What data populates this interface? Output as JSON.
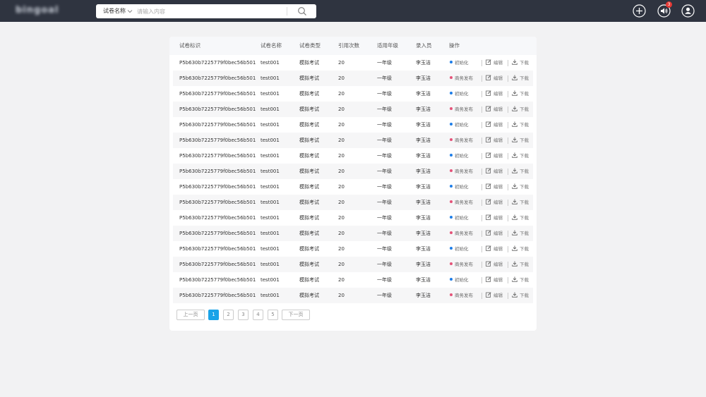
{
  "header": {
    "logo_text": "bingoal",
    "search": {
      "category": "试卷名称",
      "placeholder": "请输入内容"
    },
    "notification_count": "3"
  },
  "table": {
    "columns": [
      "试卷标识",
      "试卷名称",
      "试卷类型",
      "引用次数",
      "适用年级",
      "录入员",
      "操作"
    ],
    "rows": [
      {
        "id": "P5b630b7225779f0bec56b501",
        "name": "test001",
        "type": "模拟考试",
        "refs": "20",
        "grade": "一年级",
        "author": "李玉洁",
        "status": "初始化",
        "status_color": "#1e7ee8",
        "edit": "编辑",
        "download": "下载"
      },
      {
        "id": "P5b630b7225779f0bec56b501",
        "name": "test001",
        "type": "模拟考试",
        "refs": "20",
        "grade": "一年级",
        "author": "李玉洁",
        "status": "商务发布",
        "status_color": "#e5547a",
        "edit": "编辑",
        "download": "下载"
      },
      {
        "id": "P5b630b7225779f0bec56b501",
        "name": "test001",
        "type": "模拟考试",
        "refs": "20",
        "grade": "一年级",
        "author": "李玉洁",
        "status": "初始化",
        "status_color": "#1e7ee8",
        "edit": "编辑",
        "download": "下载"
      },
      {
        "id": "P5b630b7225779f0bec56b501",
        "name": "test001",
        "type": "模拟考试",
        "refs": "20",
        "grade": "一年级",
        "author": "李玉洁",
        "status": "商务发布",
        "status_color": "#e5547a",
        "edit": "编辑",
        "download": "下载"
      },
      {
        "id": "P5b630b7225779f0bec56b501",
        "name": "test001",
        "type": "模拟考试",
        "refs": "20",
        "grade": "一年级",
        "author": "李玉洁",
        "status": "初始化",
        "status_color": "#1e7ee8",
        "edit": "编辑",
        "download": "下载"
      },
      {
        "id": "P5b630b7225779f0bec56b501",
        "name": "test001",
        "type": "模拟考试",
        "refs": "20",
        "grade": "一年级",
        "author": "李玉洁",
        "status": "商务发布",
        "status_color": "#e5547a",
        "edit": "编辑",
        "download": "下载"
      },
      {
        "id": "P5b630b7225779f0bec56b501",
        "name": "test001",
        "type": "模拟考试",
        "refs": "20",
        "grade": "一年级",
        "author": "李玉洁",
        "status": "初始化",
        "status_color": "#1e7ee8",
        "edit": "编辑",
        "download": "下载"
      },
      {
        "id": "P5b630b7225779f0bec56b501",
        "name": "test001",
        "type": "模拟考试",
        "refs": "20",
        "grade": "一年级",
        "author": "李玉洁",
        "status": "商务发布",
        "status_color": "#e5547a",
        "edit": "编辑",
        "download": "下载"
      },
      {
        "id": "P5b630b7225779f0bec56b501",
        "name": "test001",
        "type": "模拟考试",
        "refs": "20",
        "grade": "一年级",
        "author": "李玉洁",
        "status": "初始化",
        "status_color": "#1e7ee8",
        "edit": "编辑",
        "download": "下载"
      },
      {
        "id": "P5b630b7225779f0bec56b501",
        "name": "test001",
        "type": "模拟考试",
        "refs": "20",
        "grade": "一年级",
        "author": "李玉洁",
        "status": "商务发布",
        "status_color": "#e5547a",
        "edit": "编辑",
        "download": "下载"
      },
      {
        "id": "P5b630b7225779f0bec56b501",
        "name": "test001",
        "type": "模拟考试",
        "refs": "20",
        "grade": "一年级",
        "author": "李玉洁",
        "status": "初始化",
        "status_color": "#1e7ee8",
        "edit": "编辑",
        "download": "下载"
      },
      {
        "id": "P5b630b7225779f0bec56b501",
        "name": "test001",
        "type": "模拟考试",
        "refs": "20",
        "grade": "一年级",
        "author": "李玉洁",
        "status": "商务发布",
        "status_color": "#e5547a",
        "edit": "编辑",
        "download": "下载"
      },
      {
        "id": "P5b630b7225779f0bec56b501",
        "name": "test001",
        "type": "模拟考试",
        "refs": "20",
        "grade": "一年级",
        "author": "李玉洁",
        "status": "初始化",
        "status_color": "#1e7ee8",
        "edit": "编辑",
        "download": "下载"
      },
      {
        "id": "P5b630b7225779f0bec56b501",
        "name": "test001",
        "type": "模拟考试",
        "refs": "20",
        "grade": "一年级",
        "author": "李玉洁",
        "status": "商务发布",
        "status_color": "#e5547a",
        "edit": "编辑",
        "download": "下载"
      },
      {
        "id": "P5b630b7225779f0bec56b501",
        "name": "test001",
        "type": "模拟考试",
        "refs": "20",
        "grade": "一年级",
        "author": "李玉洁",
        "status": "初始化",
        "status_color": "#1e7ee8",
        "edit": "编辑",
        "download": "下载"
      },
      {
        "id": "P5b630b7225779f0bec56b501",
        "name": "test001",
        "type": "模拟考试",
        "refs": "20",
        "grade": "一年级",
        "author": "李玉洁",
        "status": "商务发布",
        "status_color": "#e5547a",
        "edit": "编辑",
        "download": "下载"
      }
    ]
  },
  "pagination": {
    "prev": "上一页",
    "pages": [
      "1",
      "2",
      "3",
      "4",
      "5"
    ],
    "current": "1",
    "next": "下一页"
  }
}
